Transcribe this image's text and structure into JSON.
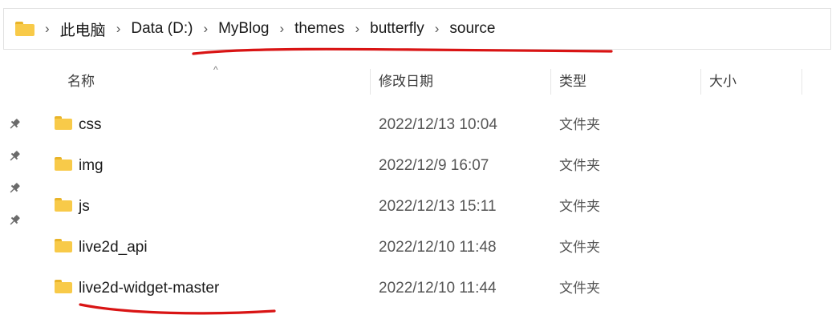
{
  "address_bar": {
    "folder_icon": "folder-icon",
    "separator": "›",
    "crumbs": [
      "此电脑",
      "Data (D:)",
      "MyBlog",
      "themes",
      "butterfly",
      "source"
    ]
  },
  "columns": {
    "name": "名称",
    "modified": "修改日期",
    "type": "类型",
    "size": "大小",
    "sort_indicator": "^"
  },
  "files": [
    {
      "name": "css",
      "modified": "2022/12/13 10:04",
      "type": "文件夹"
    },
    {
      "name": "img",
      "modified": "2022/12/9 16:07",
      "type": "文件夹"
    },
    {
      "name": "js",
      "modified": "2022/12/13 15:11",
      "type": "文件夹"
    },
    {
      "name": "live2d_api",
      "modified": "2022/12/10 11:48",
      "type": "文件夹"
    },
    {
      "name": "live2d-widget-master",
      "modified": "2022/12/10 11:44",
      "type": "文件夹"
    }
  ],
  "quick_access_pins": [
    "pin-icon",
    "pin-icon",
    "pin-icon",
    "pin-icon"
  ],
  "colors": {
    "folder": "#f8ca49",
    "folder_tab": "#e9b429",
    "annotation": "#d91414"
  }
}
